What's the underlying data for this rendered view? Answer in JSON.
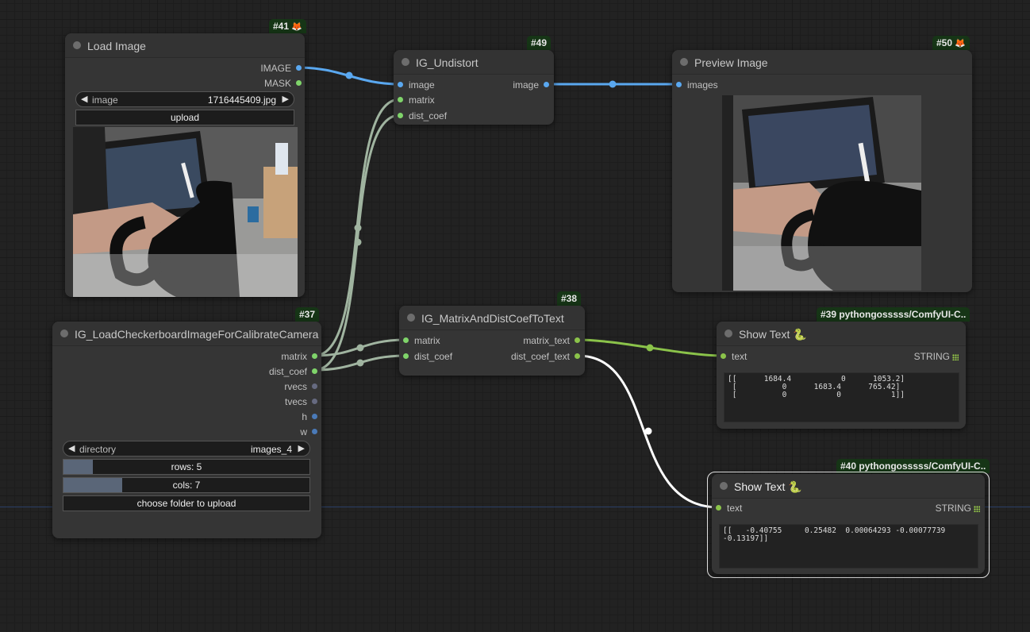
{
  "colors": {
    "image_link": "#5aa8f0",
    "matrix_link": "#a0b4a0",
    "string_link": "#8bc34a",
    "text_link": "#ffffff",
    "pin_green": "#7fd46a",
    "pin_blue": "#5aa8f0",
    "pin_gray": "#666a80"
  },
  "nodes": {
    "load_image": {
      "id": "#41",
      "emoji": "🦊",
      "title": "Load Image",
      "outputs": [
        "IMAGE",
        "MASK"
      ],
      "image_label": "image",
      "image_value": "1716445409.jpg",
      "upload_label": "upload"
    },
    "undistort": {
      "id": "#49",
      "title": "IG_Undistort",
      "inputs": [
        "image",
        "matrix",
        "dist_coef"
      ],
      "outputs": [
        "image"
      ]
    },
    "preview": {
      "id": "#50",
      "emoji": "🦊",
      "title": "Preview Image",
      "inputs": [
        "images"
      ]
    },
    "checkerboard": {
      "id": "#37",
      "title": "IG_LoadCheckerboardImageForCalibrateCamera",
      "outputs": [
        "matrix",
        "dist_coef",
        "rvecs",
        "tvecs",
        "h",
        "w"
      ],
      "directory_label": "directory",
      "directory_value": "images_4",
      "rows_text": "rows: 5",
      "rows_fraction": 0.12,
      "cols_text": "cols: 7",
      "cols_fraction": 0.24,
      "upload_folder_label": "choose folder to upload"
    },
    "matrix_to_text": {
      "id": "#38",
      "title": "IG_MatrixAndDistCoefToText",
      "inputs": [
        "matrix",
        "dist_coef"
      ],
      "outputs": [
        "matrix_text",
        "dist_coef_text"
      ]
    },
    "show_text_39": {
      "id": "#39 pythongosssss/ComfyUI-C..",
      "title": "Show Text 🐍",
      "input": "text",
      "type": "STRING",
      "content": "[[      1684.4           0      1053.2]\n [          0      1683.4      765.42]\n [          0           0           1]]"
    },
    "show_text_40": {
      "id": "#40 pythongosssss/ComfyUI-C..",
      "title": "Show Text 🐍",
      "input": "text",
      "type": "STRING",
      "content": "[[   -0.40755     0.25482  0.00064293 -0.00077739\n-0.13197]]"
    }
  }
}
